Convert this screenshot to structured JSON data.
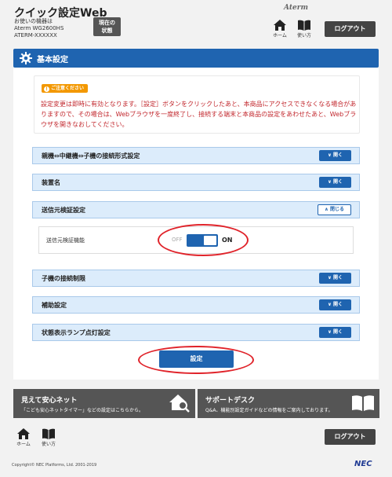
{
  "header": {
    "app_title": "クイック設定Web",
    "device_caption": "お使いの機器は",
    "device_model": "Aterm WG2600HS",
    "device_name": "ATERM-XXXXXX",
    "status_button": "現在の\n状態",
    "brand": "Aterm",
    "home_label": "ホーム",
    "help_label": "使い方",
    "logout_label": "ログアウト"
  },
  "page": {
    "title": "基本設定"
  },
  "notice": {
    "badge": "ご注意ください",
    "text": "設定変更は即時に有効となります。［設定］ボタンをクリックしたあと、本商品にアクセスできなくなる場合がありますので、その場合は、Webブラウザを一度終了し、接続する端末と本商品の設定をあわせたあと、Webブラウザを開きなおしてください。"
  },
  "sections": [
    {
      "label": "親機⇔中継機⇔子機の接続形式設定",
      "toggle": "開く"
    },
    {
      "label": "装置名",
      "toggle": "開く"
    },
    {
      "label": "送信元検証設定",
      "toggle": "閉じる"
    },
    {
      "label": "子機の接続制限",
      "toggle": "開く"
    },
    {
      "label": "補助設定",
      "toggle": "開く"
    },
    {
      "label": "状態表示ランプ点灯設定",
      "toggle": "開く"
    }
  ],
  "source_verification": {
    "label": "送信元検証機能",
    "off_label": "OFF",
    "on_label": "ON",
    "state": "ON"
  },
  "submit_label": "設定",
  "banners": {
    "left_title": "見えて安心ネット",
    "left_desc": "「こども安心ネットタイマー」などの設定はこちらから。",
    "right_title": "サポートデスク",
    "right_desc": "Q&A、機能別設定ガイドなどの情報をご案内しております。"
  },
  "footer": {
    "home_label": "ホーム",
    "help_label": "使い方",
    "logout_label": "ログアウト",
    "copyright": "Copyright© NEC Platforms, Ltd. 2001-2019",
    "logo": "NEC"
  },
  "colors": {
    "primary": "#1f64b0",
    "notice_text": "#c2272d",
    "badge": "#f39800",
    "highlight": "#e0232a"
  }
}
